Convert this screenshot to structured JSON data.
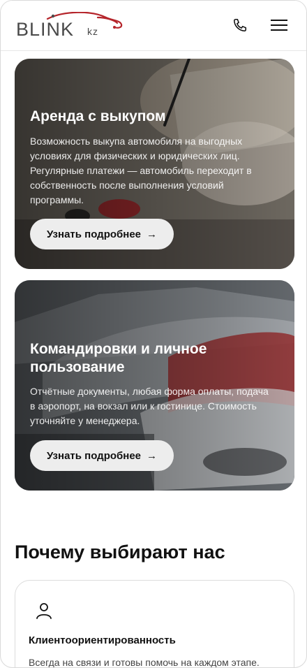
{
  "header": {
    "logo_main": "BLINK",
    "logo_sub": "kz",
    "phone_icon": "phone-icon",
    "menu_icon": "hamburger-menu-icon"
  },
  "cards": [
    {
      "title": "Аренда с выкупом",
      "text": "Возможность выкупа автомобиля на выгодных условиях для физических и юридических лиц. Регулярные платежи — автомобиль переходит в собственность после выполнения условий программы.",
      "button_label": "Узнать подробнее",
      "button_arrow": "→"
    },
    {
      "title": "Командировки и личное пользование",
      "text": "Отчётные документы, любая форма оплаты, подача в аэропорт, на вокзал или к гостинице. Стоимость уточняйте у менеджера.",
      "button_label": "Узнать подробнее",
      "button_arrow": "→"
    }
  ],
  "why": {
    "title": "Почему выбирают нас",
    "features": [
      {
        "icon": "user-icon",
        "title": "Клиентоориентированность",
        "text": "Всегда на связи и готовы помочь на каждом этапе."
      }
    ]
  },
  "colors": {
    "logo_accent": "#b5252b",
    "logo_text": "#4a4a4a",
    "button_bg": "#ededed"
  }
}
